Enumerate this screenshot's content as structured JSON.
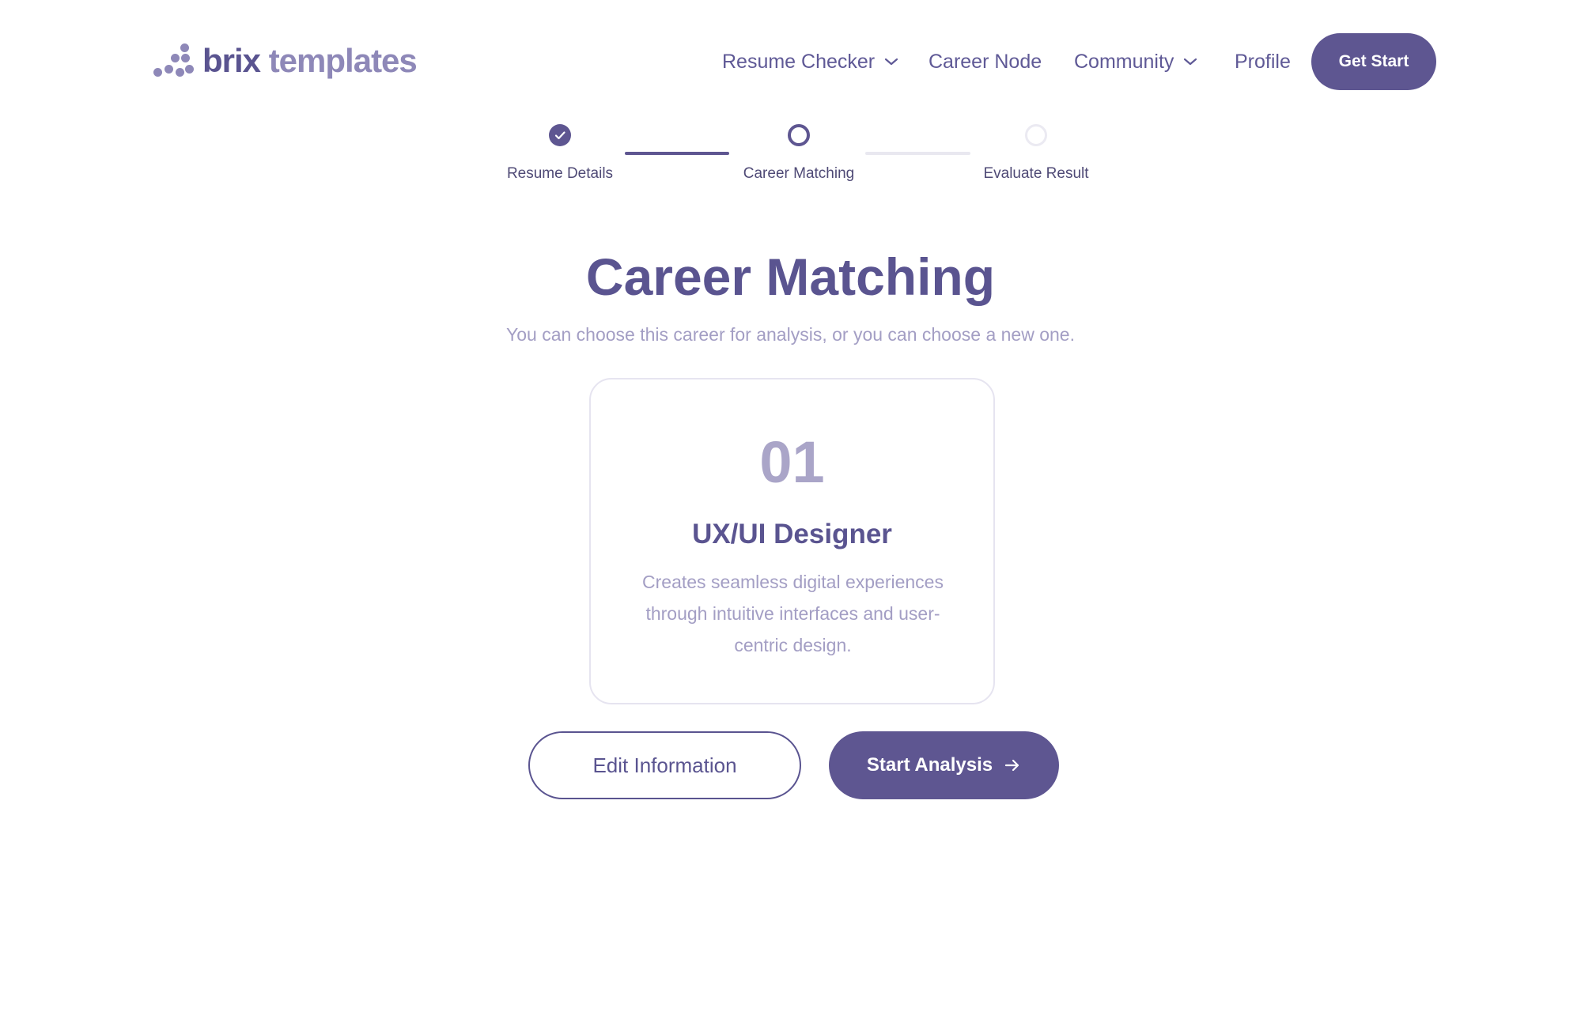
{
  "header": {
    "logo": {
      "brand": "brix",
      "rest": " templates"
    },
    "nav": [
      {
        "label": "Resume Checker",
        "has_dropdown": true
      },
      {
        "label": "Career Node",
        "has_dropdown": false
      },
      {
        "label": "Community",
        "has_dropdown": true
      },
      {
        "label": "Profile",
        "has_dropdown": false
      }
    ],
    "cta_label": "Get Start"
  },
  "stepper": {
    "steps": [
      {
        "label": "Resume Details",
        "state": "completed"
      },
      {
        "label": "Career Matching",
        "state": "current"
      },
      {
        "label": "Evaluate Result",
        "state": "upcoming"
      }
    ]
  },
  "main": {
    "title": "Career Matching",
    "subtitle": "You can choose this career for analysis, or you can choose a new one.",
    "card": {
      "number": "01",
      "role": "UX/UI Designer",
      "description": "Creates seamless digital experiences through intuitive interfaces and user-centric design."
    },
    "edit_label": "Edit Information",
    "start_label": "Start Analysis"
  },
  "icons": {
    "check": "check-icon",
    "chevron": "chevron-down-icon",
    "arrow": "arrow-right-icon"
  },
  "colors": {
    "primary": "#5e5691",
    "muted": "#a39ec4",
    "line_inactive": "#e9e8f0"
  }
}
